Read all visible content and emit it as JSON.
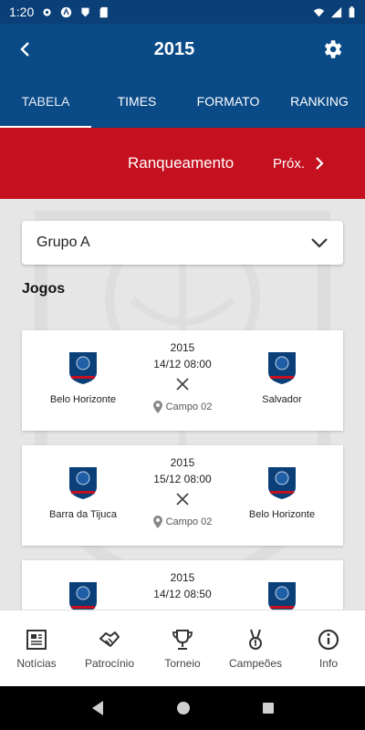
{
  "status_bar": {
    "time": "1:20"
  },
  "app_bar": {
    "title": "2015"
  },
  "tabs": [
    {
      "label": "TABELA",
      "active": true
    },
    {
      "label": "TIMES",
      "active": false
    },
    {
      "label": "FORMATO",
      "active": false
    },
    {
      "label": "RANKING",
      "active": false
    }
  ],
  "banner": {
    "rank_label": "Ranqueamento",
    "next_label": "Próx."
  },
  "group_select": {
    "value": "Grupo A"
  },
  "section_title": "Jogos",
  "matches": [
    {
      "home": "Belo Horizonte",
      "away": "Salvador",
      "year": "2015",
      "datetime": "14/12 08:00",
      "place": "Campo 02"
    },
    {
      "home": "Barra da Tijuca",
      "away": "Belo Horizonte",
      "year": "2015",
      "datetime": "15/12 08:00",
      "place": "Campo 02"
    },
    {
      "home": "",
      "away": "",
      "year": "2015",
      "datetime": "14/12 08:50",
      "place": ""
    }
  ],
  "bottom_nav": [
    {
      "label": "Notícias",
      "icon": "news-icon"
    },
    {
      "label": "Patrocínio",
      "icon": "handshake-icon"
    },
    {
      "label": "Torneio",
      "icon": "trophy-icon"
    },
    {
      "label": "Campeões",
      "icon": "medal-icon"
    },
    {
      "label": "Info",
      "icon": "info-icon"
    }
  ],
  "colors": {
    "primary": "#0a4a86",
    "status": "#0a3f78",
    "banner": "#c4101f"
  }
}
